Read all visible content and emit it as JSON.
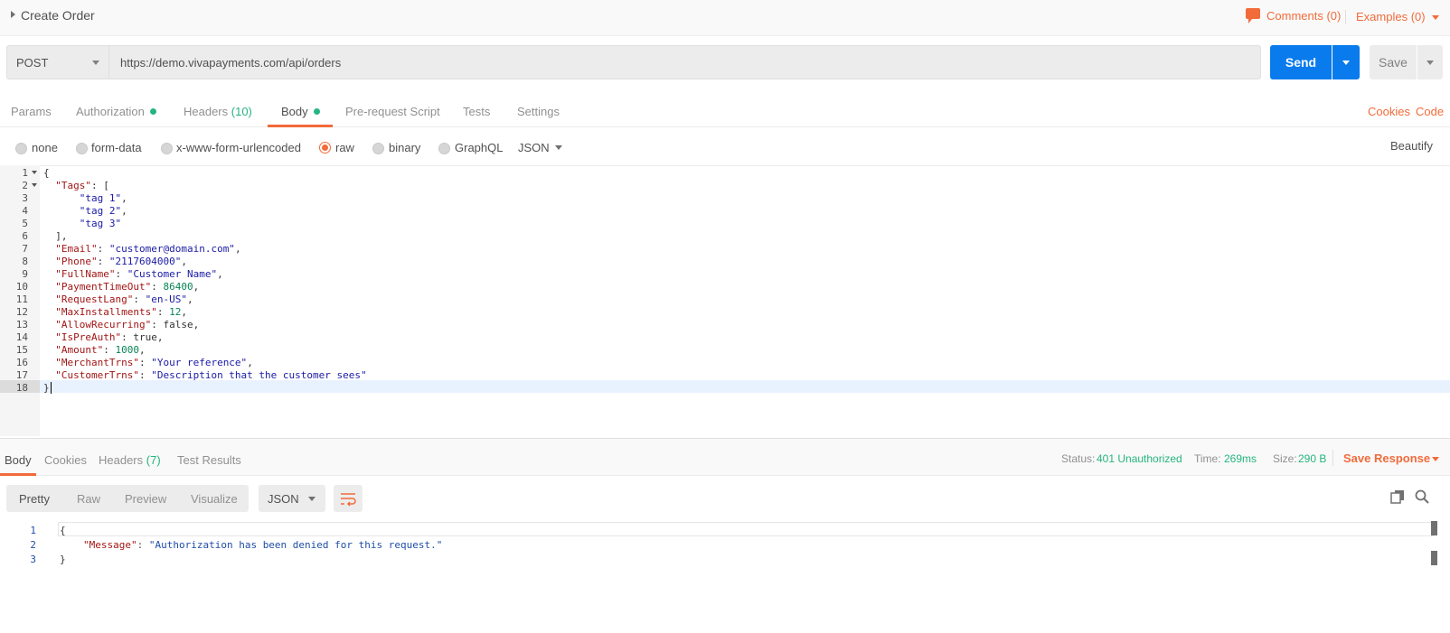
{
  "header": {
    "title": "Create Order",
    "comments_label": "Comments (0)",
    "examples_label": "Examples (0)"
  },
  "request": {
    "method": "POST",
    "url": "https://demo.vivapayments.com/api/orders",
    "send_label": "Send",
    "save_label": "Save"
  },
  "req_tabs": {
    "params": "Params",
    "authorization": "Authorization",
    "headers": "Headers",
    "headers_count": "(10)",
    "body": "Body",
    "prerequest": "Pre-request Script",
    "tests": "Tests",
    "settings": "Settings",
    "cookies": "Cookies",
    "code": "Code"
  },
  "body_types": {
    "none": "none",
    "form_data": "form-data",
    "urlencoded": "x-www-form-urlencoded",
    "raw": "raw",
    "binary": "binary",
    "graphql": "GraphQL",
    "format": "JSON",
    "beautify": "Beautify"
  },
  "editor": {
    "line_numbers": [
      "1",
      "2",
      "3",
      "4",
      "5",
      "6",
      "7",
      "8",
      "9",
      "10",
      "11",
      "12",
      "13",
      "14",
      "15",
      "16",
      "17",
      "18"
    ],
    "lines": {
      "l1": "{",
      "l2_key": "\"Tags\"",
      "l2_rest": ": [",
      "l3": "\"tag 1\"",
      "l4": "\"tag 2\"",
      "l5": "\"tag 3\"",
      "l6": "],",
      "l7_key": "\"Email\"",
      "l7_val": "\"customer@domain.com\"",
      "l8_key": "\"Phone\"",
      "l8_val": "\"2117604000\"",
      "l9_key": "\"FullName\"",
      "l9_val": "\"Customer Name\"",
      "l10_key": "\"PaymentTimeOut\"",
      "l10_val": "86400",
      "l11_key": "\"RequestLang\"",
      "l11_val": "\"en-US\"",
      "l12_key": "\"MaxInstallments\"",
      "l12_val": "12",
      "l13_key": "\"AllowRecurring\"",
      "l13_val": "false",
      "l14_key": "\"IsPreAuth\"",
      "l14_val": "true",
      "l15_key": "\"Amount\"",
      "l15_val": "1000",
      "l16_key": "\"MerchantTrns\"",
      "l16_val": "\"Your reference\"",
      "l17_key": "\"CustomerTrns\"",
      "l17_val": "\"Description that the customer sees\"",
      "l18": "}"
    }
  },
  "response": {
    "tabs": {
      "body": "Body",
      "cookies": "Cookies",
      "headers": "Headers",
      "headers_count": "(7)",
      "test_results": "Test Results"
    },
    "status_label": "Status:",
    "status_value": "401 Unauthorized",
    "time_label": "Time:",
    "time_value": "269ms",
    "size_label": "Size:",
    "size_value": "290 B",
    "save_response": "Save Response",
    "views": {
      "pretty": "Pretty",
      "raw": "Raw",
      "preview": "Preview",
      "visualize": "Visualize"
    },
    "format": "JSON",
    "line_numbers": [
      "1",
      "2",
      "3"
    ],
    "lines": {
      "l1": "{",
      "l2_key": "\"Message\"",
      "l2_val": "\"Authorization has been denied for this request.\"",
      "l3": "}"
    }
  },
  "colors": {
    "accent": "#f26b3a",
    "send_blue": "#097bed",
    "success_green": "#26b47f"
  }
}
